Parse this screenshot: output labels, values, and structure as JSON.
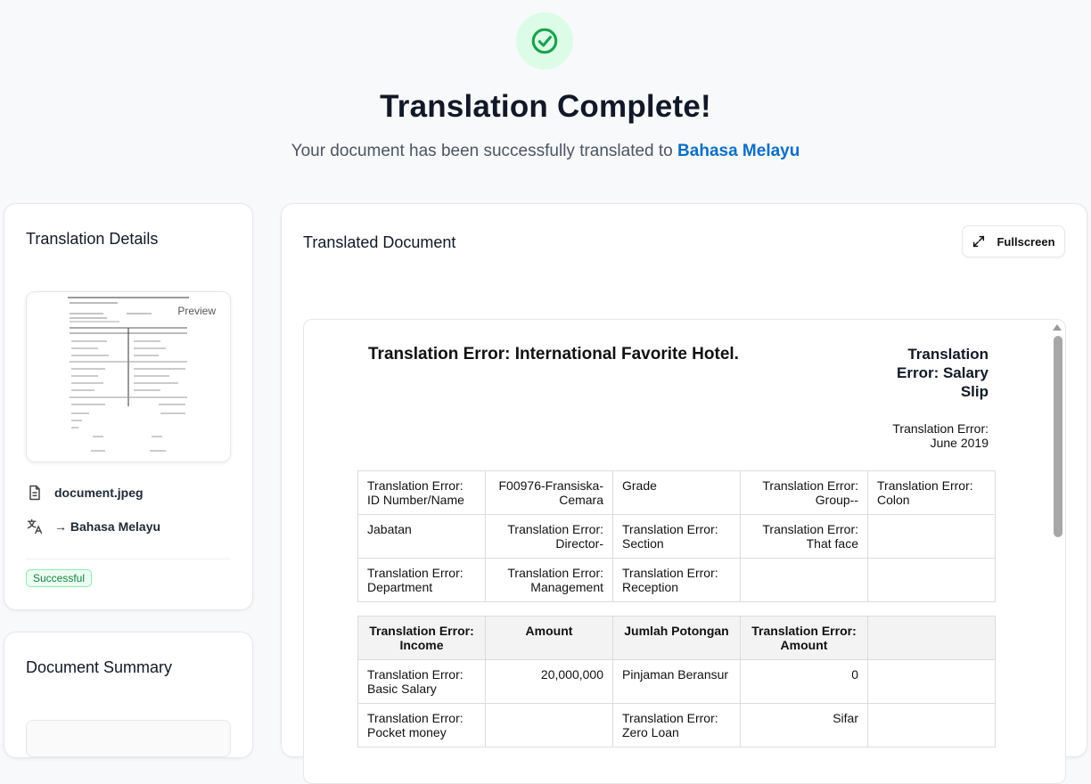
{
  "header": {
    "title": "Translation Complete!",
    "subtitle_prefix": "Your document has been successfully translated to",
    "language": "Bahasa Melayu"
  },
  "details": {
    "title": "Translation Details",
    "preview_label": "Preview",
    "file_name": "document.jpeg",
    "target_language": "→ Bahasa Melayu",
    "status": "Successful"
  },
  "summary": {
    "title": "Document Summary"
  },
  "document": {
    "title": "Translated Document",
    "fullscreen_label": "Fullscreen",
    "heading": "Translation Error: International Favorite Hotel.",
    "right_title_lines": [
      "Translation",
      "Error: Salary",
      "Slip"
    ],
    "date_lines": [
      "Translation Error:",
      "June 2019"
    ],
    "info_rows": [
      [
        "Translation Error: ID Number/Name",
        "F00976-Fransiska-Cemara",
        "Grade",
        "Translation Error: Group--",
        "Translation Error: Colon"
      ],
      [
        "Jabatan",
        "Translation Error: Director-",
        "Translation Error: Section",
        "Translation Error: That face",
        ""
      ],
      [
        "Translation Error: Department",
        "Translation Error: Management",
        "Translation Error: Reception",
        "",
        ""
      ]
    ],
    "pay_headers": [
      "Translation Error: Income",
      "Amount",
      "Jumlah Potongan",
      "Translation Error: Amount",
      ""
    ],
    "pay_rows": [
      [
        "Translation Error: Basic Salary",
        "20,000,000",
        "Pinjaman Beransur",
        "0",
        ""
      ],
      [
        "Translation Error: Pocket money",
        "",
        "Translation Error: Zero Loan",
        "Sifar",
        ""
      ]
    ]
  },
  "colors": {
    "accent": "#0b6fc7",
    "success": "#15803d",
    "success_bg": "#dcfce7"
  }
}
